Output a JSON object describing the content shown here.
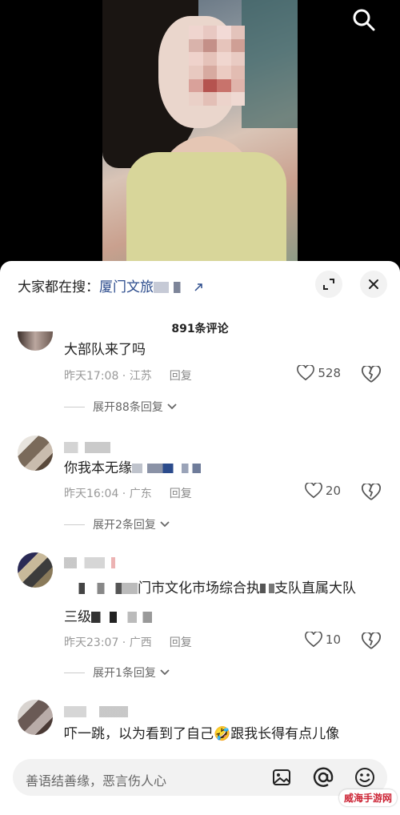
{
  "hot_search": {
    "prefix": "大家都在搜：",
    "query": "厦门文旅"
  },
  "comments_header": {
    "count_label": "891条评论"
  },
  "input": {
    "placeholder": "善语结善缘，恶言伤人心"
  },
  "watermark": "威海手游网",
  "comments": [
    {
      "text": "大部队来了吗",
      "time": "昨天17:08",
      "location": "江苏",
      "reply": "回复",
      "likes": "528",
      "expand": "展开88条回复"
    },
    {
      "text_start": "你我本无缘",
      "text_end": "",
      "time": "昨天16:04",
      "location": "广东",
      "reply": "回复",
      "likes": "20",
      "expand": "展开2条回复"
    },
    {
      "line1": "门市文化市场综合执",
      "line1_end": "支队直属大队",
      "line2": "三级",
      "time": "昨天23:07",
      "location": "广西",
      "reply": "回复",
      "likes": "10",
      "expand": "展开1条回复"
    },
    {
      "text_start": "吓一跳，以为看到了自己",
      "emoji": "🤣",
      "text_end": "跟我长得有点儿像"
    }
  ],
  "colors": {
    "link": "#2b4b8c",
    "meta": "#999999",
    "background": "#ffffff"
  }
}
